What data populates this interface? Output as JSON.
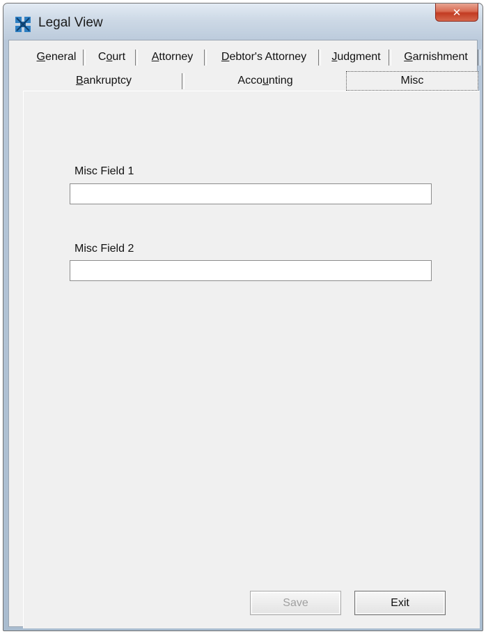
{
  "window": {
    "title": "Legal View",
    "close_label": "✕"
  },
  "tabs_row1": [
    {
      "label": "General",
      "access": "G"
    },
    {
      "label": "Court",
      "access": "o"
    },
    {
      "label": "Attorney",
      "access": "A"
    },
    {
      "label": "Debtor's Attorney",
      "access": "D"
    },
    {
      "label": "Judgment",
      "access": "J"
    },
    {
      "label": "Garnishment",
      "access": "G"
    }
  ],
  "tabs_row2": [
    {
      "label": "Bankruptcy",
      "access": "B"
    },
    {
      "label": "Accounting",
      "access": "u"
    },
    {
      "label": "Misc",
      "access": "",
      "selected": true
    }
  ],
  "misc": {
    "field1_label": "Misc Field 1",
    "field1_value": "",
    "field2_label": "Misc Field 2",
    "field2_value": ""
  },
  "buttons": {
    "save": "Save",
    "exit": "Exit"
  }
}
